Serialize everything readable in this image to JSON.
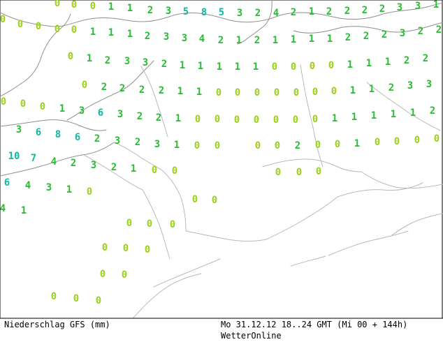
{
  "map": {
    "footer": {
      "left": "Niederschlag GFS (mm)",
      "right": "Mo 31.12.12 18..24 GMT (Mi 00 + 144h)",
      "source": "WetterOnline"
    },
    "colors": {
      "light": "#9ad11b",
      "mid": "#26bd32",
      "heavy": "#12b8a0",
      "border": "#b9b9b9",
      "coast": "#8f8f8f",
      "frame": "#000000"
    }
  }
}
